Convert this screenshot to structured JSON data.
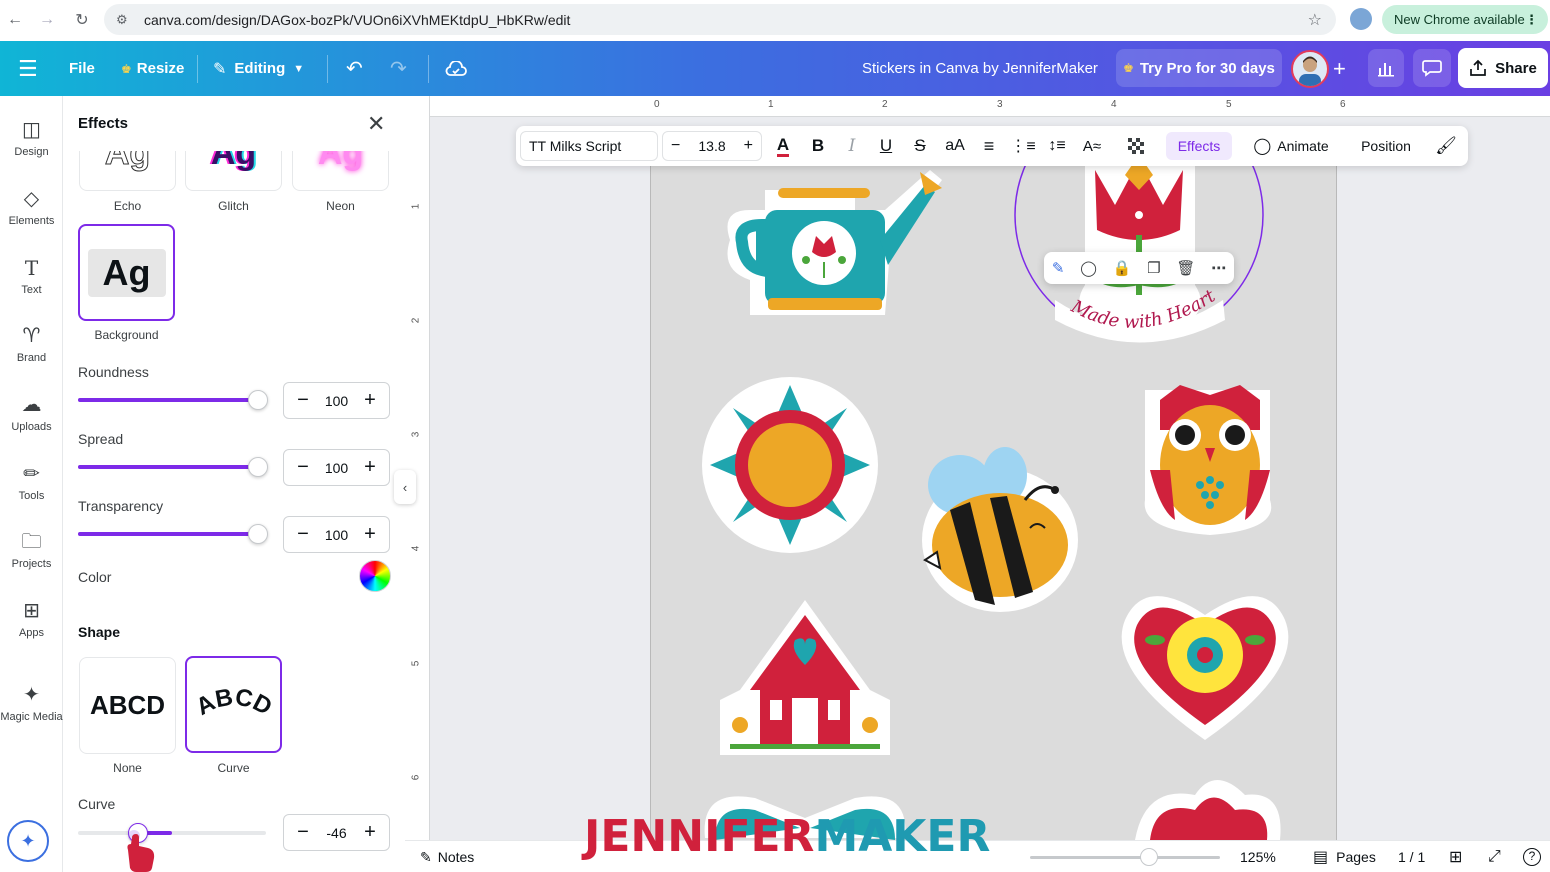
{
  "browser": {
    "url": "canva.com/design/DAGox-bozPk/VUOn6iXVhMEKtdpU_HbKRw/edit",
    "update_pill": "New Chrome available"
  },
  "header": {
    "file": "File",
    "resize": "Resize",
    "editing": "Editing",
    "doc_title": "Stickers in Canva by JenniferMaker",
    "try_pro": "Try Pro for 30 days",
    "share": "Share",
    "colors": {
      "gradient_start": "#10b5d6",
      "gradient_mid": "#3b6fe0",
      "gradient_end": "#6a3fe3"
    }
  },
  "rail": {
    "items": [
      {
        "label": "Design",
        "icon": "layout-icon"
      },
      {
        "label": "Elements",
        "icon": "shapes-icon"
      },
      {
        "label": "Text",
        "icon": "text-icon"
      },
      {
        "label": "Brand",
        "icon": "brand-icon"
      },
      {
        "label": "Uploads",
        "icon": "cloud-upload-icon"
      },
      {
        "label": "Tools",
        "icon": "pen-icon"
      },
      {
        "label": "Projects",
        "icon": "folder-icon"
      },
      {
        "label": "Apps",
        "icon": "apps-icon"
      },
      {
        "label": "Magic Media",
        "icon": "magic-media-icon"
      }
    ]
  },
  "panel": {
    "title": "Effects",
    "styles": [
      {
        "label": "Echo",
        "preview": "Ag"
      },
      {
        "label": "Glitch",
        "preview": "Ag"
      },
      {
        "label": "Neon",
        "preview": "Ag"
      },
      {
        "label": "Background",
        "preview": "Ag",
        "selected": true
      }
    ],
    "roundness": {
      "label": "Roundness",
      "value": "100",
      "fraction": 1.0
    },
    "spread": {
      "label": "Spread",
      "value": "100",
      "fraction": 1.0
    },
    "transparency": {
      "label": "Transparency",
      "value": "100",
      "fraction": 1.0
    },
    "color_label": "Color",
    "shape_title": "Shape",
    "shapes": [
      {
        "label": "None",
        "preview": "ABCD"
      },
      {
        "label": "Curve",
        "preview": "ABCD",
        "selected": true
      }
    ],
    "curve": {
      "label": "Curve",
      "value": "-46",
      "min": -100,
      "max": 100
    },
    "accent": "#7d2ae8"
  },
  "ruler": {
    "top": [
      "0",
      "1",
      "2",
      "3",
      "4",
      "5",
      "6"
    ],
    "left": [
      "1",
      "2",
      "3",
      "4",
      "5",
      "6"
    ]
  },
  "text_toolbar": {
    "font": "TT Milks Script",
    "size": "13.8",
    "effects": "Effects",
    "animate": "Animate",
    "position": "Position",
    "case": "aA"
  },
  "sticker_text": "Made with Heart",
  "bottom": {
    "notes": "Notes",
    "zoom": "125%",
    "pages": "Pages",
    "page_count": "1 / 1",
    "zoom_fraction": 0.6
  },
  "watermark": {
    "part1": "JENNIFER",
    "part2": "MAKER"
  }
}
